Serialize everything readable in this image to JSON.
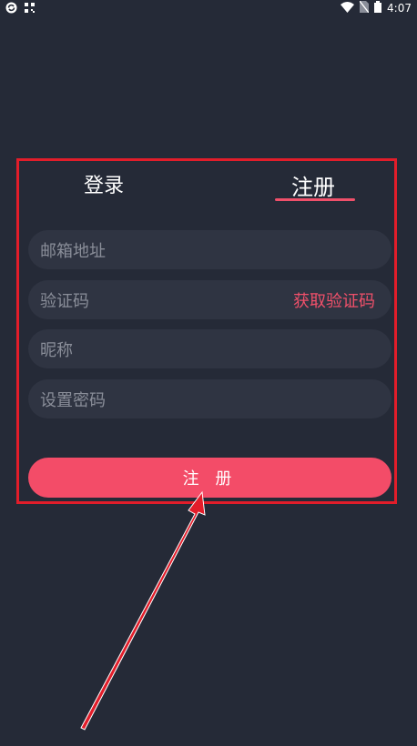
{
  "status_bar": {
    "time": "4:07",
    "icons": [
      "sync-icon",
      "qr-icon",
      "wifi-icon",
      "no-sim-icon",
      "battery-icon"
    ]
  },
  "tabs": {
    "login_label": "登录",
    "register_label": "注册"
  },
  "form": {
    "email_placeholder": "邮箱地址",
    "code_placeholder": "验证码",
    "get_code_label": "获取验证码",
    "nickname_placeholder": "昵称",
    "password_placeholder": "设置密码"
  },
  "register_button_label": "注 册",
  "colors": {
    "background": "#252a37",
    "field": "#2f3442",
    "accent": "#f34c68",
    "highlight": "#e21d2a"
  }
}
